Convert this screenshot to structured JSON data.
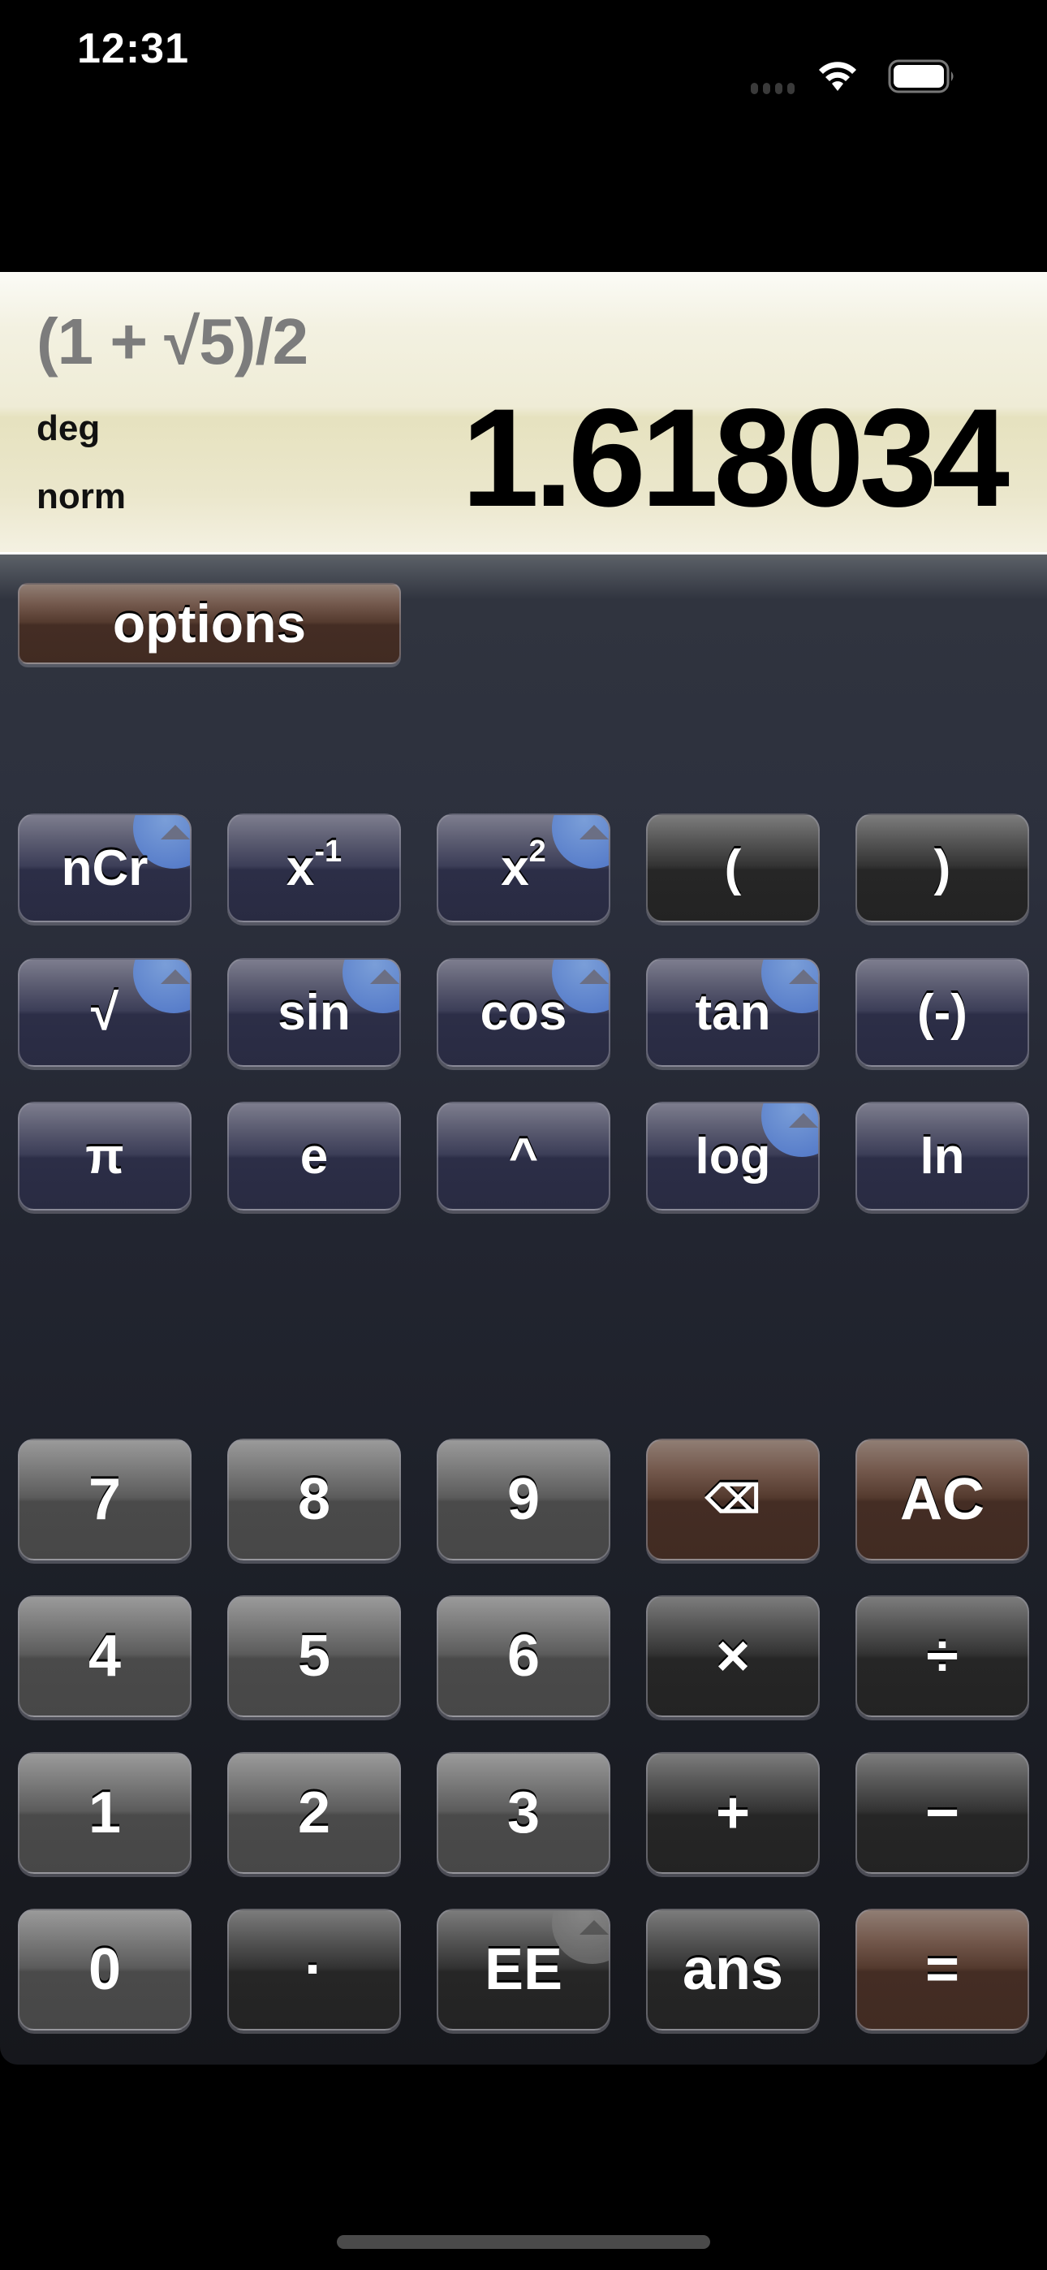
{
  "status_bar": {
    "time": "12:31",
    "icons": [
      "signal-dots-icon",
      "wifi-icon",
      "battery-icon"
    ]
  },
  "display": {
    "expression": "(1 + √5)/2",
    "angle_mode": "deg",
    "number_mode": "norm",
    "result": "1.618034"
  },
  "options_button": {
    "label": "options"
  },
  "scientific_keys": [
    [
      {
        "id": "ncr",
        "label": "nCr",
        "style": "blue",
        "has_second": true
      },
      {
        "id": "reciprocal",
        "label": "x",
        "sup": "-1",
        "style": "blue",
        "has_second": false
      },
      {
        "id": "square",
        "label": "x",
        "sup": "2",
        "style": "blue",
        "has_second": true
      },
      {
        "id": "open-paren",
        "label": "(",
        "style": "dark",
        "has_second": false
      },
      {
        "id": "close-paren",
        "label": ")",
        "style": "dark",
        "has_second": false
      }
    ],
    [
      {
        "id": "sqrt",
        "label": "√",
        "style": "blue",
        "has_second": true
      },
      {
        "id": "sin",
        "label": "sin",
        "style": "blue",
        "has_second": true
      },
      {
        "id": "cos",
        "label": "cos",
        "style": "blue",
        "has_second": true
      },
      {
        "id": "tan",
        "label": "tan",
        "style": "blue",
        "has_second": true
      },
      {
        "id": "negate",
        "label": "(-)",
        "style": "blue",
        "has_second": false
      }
    ],
    [
      {
        "id": "pi",
        "label": "π",
        "style": "blue",
        "has_second": false
      },
      {
        "id": "e",
        "label": "e",
        "style": "blue",
        "has_second": false
      },
      {
        "id": "power",
        "label": "^",
        "style": "blue",
        "has_second": false
      },
      {
        "id": "log",
        "label": "log",
        "style": "blue",
        "has_second": true
      },
      {
        "id": "ln",
        "label": "ln",
        "style": "blue",
        "has_second": false
      }
    ]
  ],
  "number_keys": [
    [
      {
        "id": "7",
        "label": "7",
        "style": "gray"
      },
      {
        "id": "8",
        "label": "8",
        "style": "gray"
      },
      {
        "id": "9",
        "label": "9",
        "style": "gray"
      },
      {
        "id": "backspace",
        "label": "⌫",
        "style": "brown"
      },
      {
        "id": "all-clear",
        "label": "AC",
        "style": "brown"
      }
    ],
    [
      {
        "id": "4",
        "label": "4",
        "style": "gray"
      },
      {
        "id": "5",
        "label": "5",
        "style": "gray"
      },
      {
        "id": "6",
        "label": "6",
        "style": "gray"
      },
      {
        "id": "multiply",
        "label": "×",
        "style": "dark"
      },
      {
        "id": "divide",
        "label": "÷",
        "style": "dark"
      }
    ],
    [
      {
        "id": "1",
        "label": "1",
        "style": "gray"
      },
      {
        "id": "2",
        "label": "2",
        "style": "gray"
      },
      {
        "id": "3",
        "label": "3",
        "style": "gray"
      },
      {
        "id": "plus",
        "label": "+",
        "style": "dark"
      },
      {
        "id": "minus",
        "label": "−",
        "style": "dark"
      }
    ],
    [
      {
        "id": "0",
        "label": "0",
        "style": "gray"
      },
      {
        "id": "decimal",
        "label": "·",
        "style": "dark"
      },
      {
        "id": "ee",
        "label": "EE",
        "style": "dark",
        "has_second": true,
        "second_style": "gray"
      },
      {
        "id": "ans",
        "label": "ans",
        "style": "dark"
      },
      {
        "id": "equals",
        "label": "=",
        "style": "brown"
      }
    ]
  ]
}
